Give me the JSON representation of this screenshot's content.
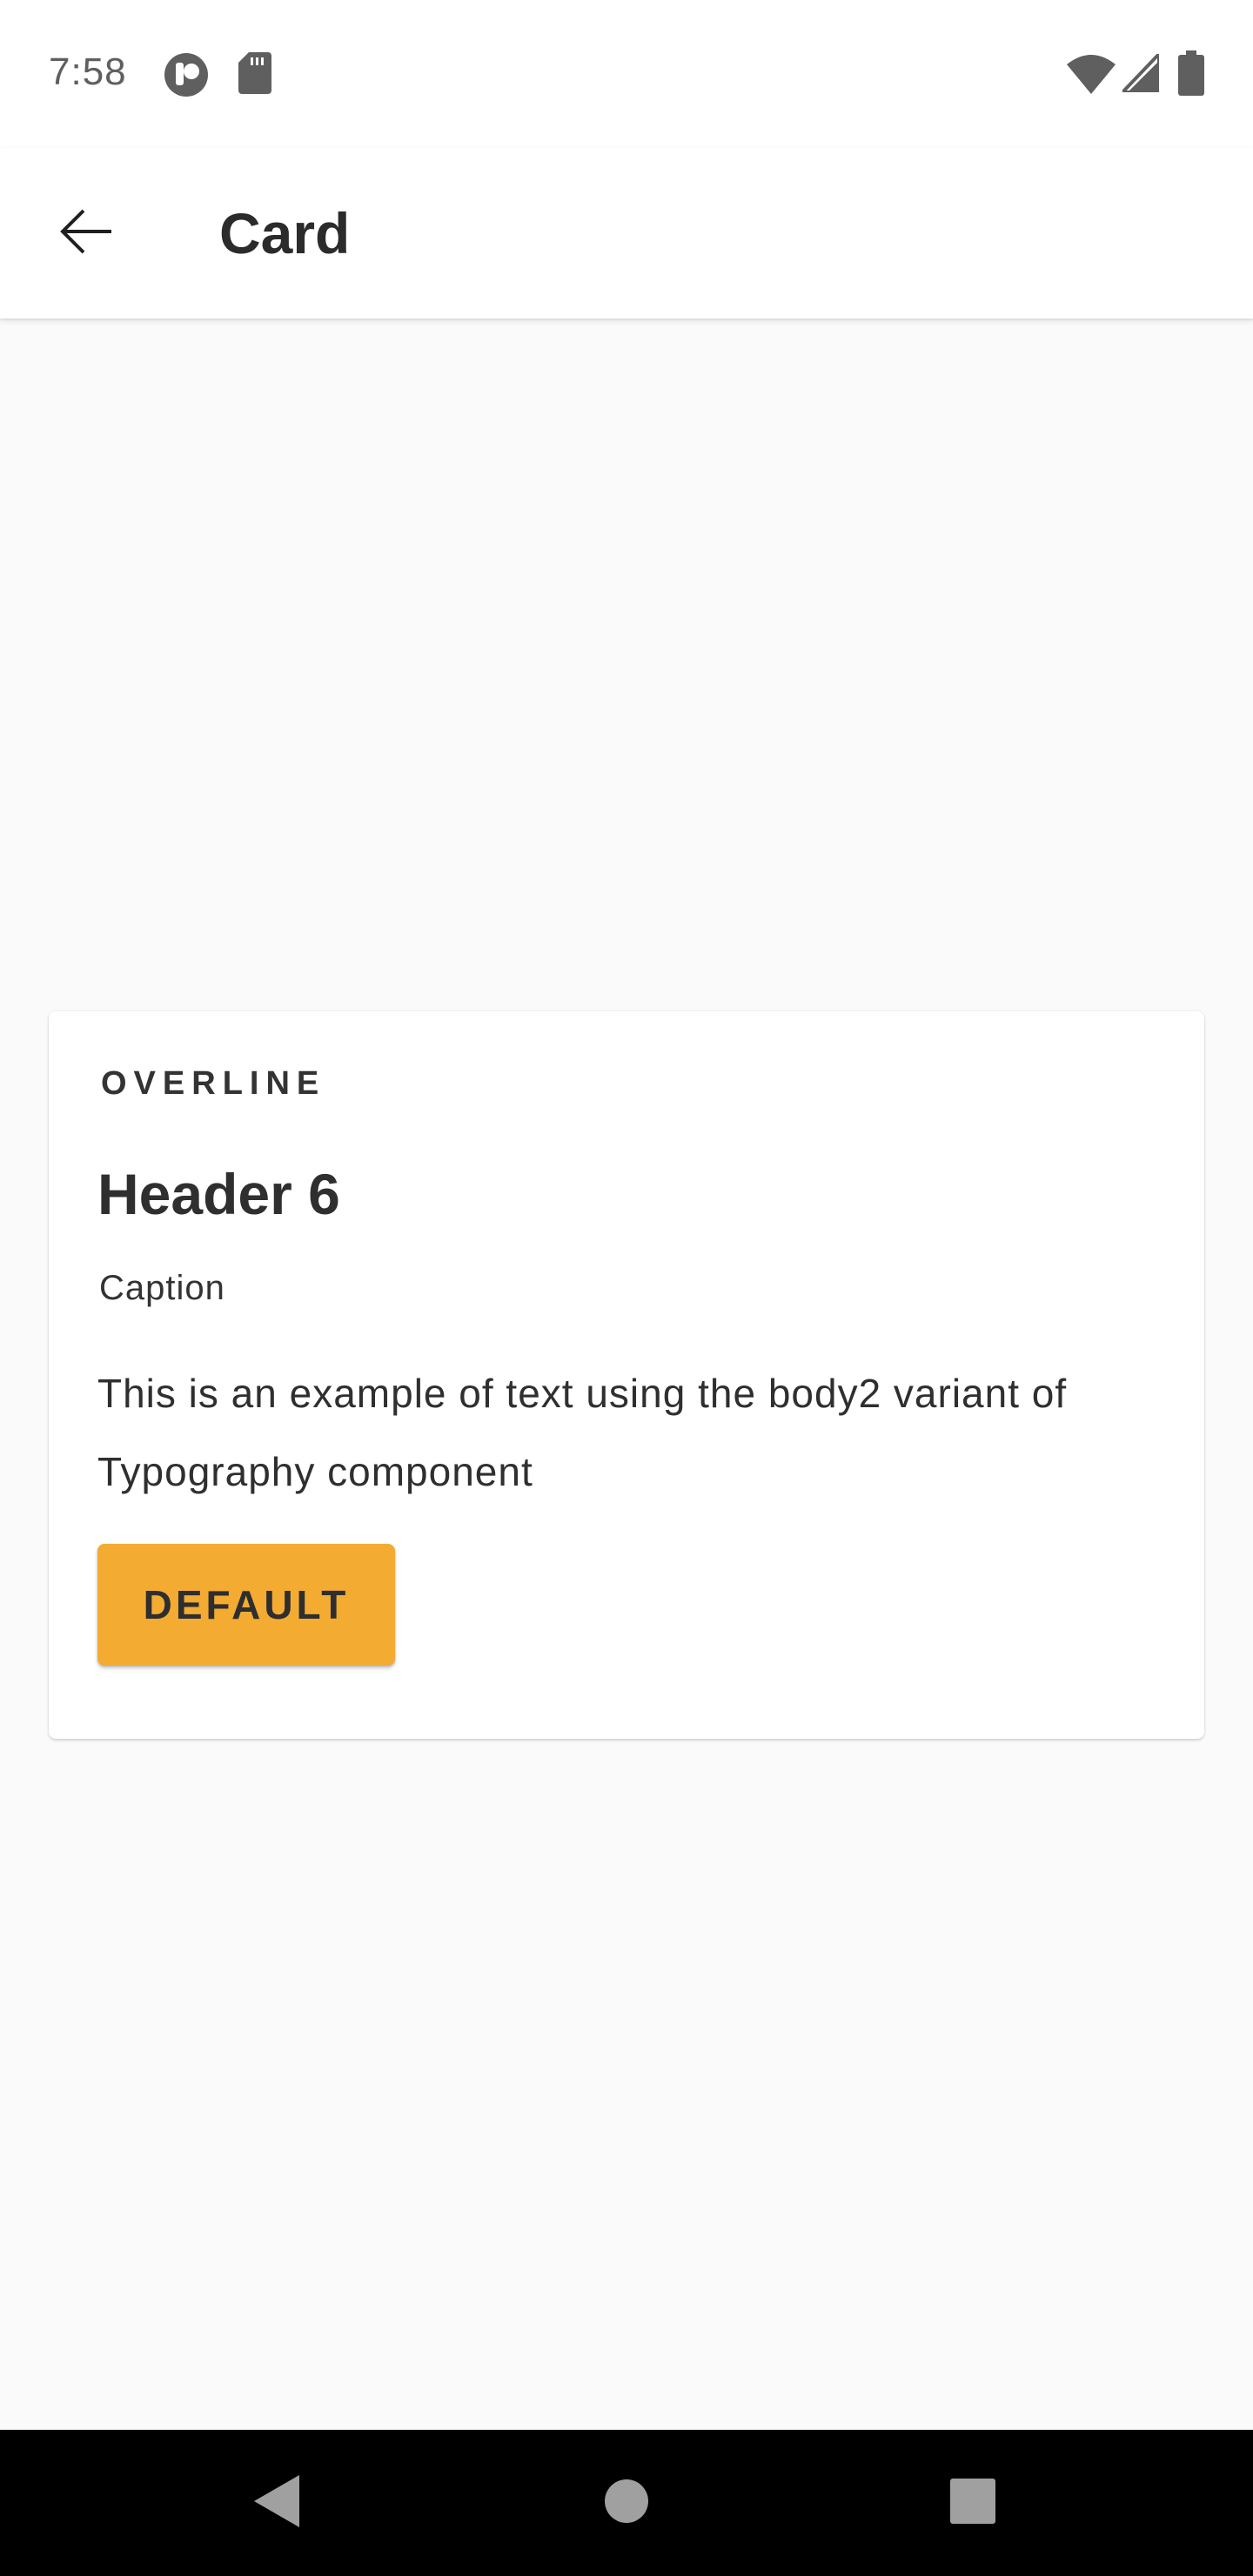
{
  "status_bar": {
    "time": "7:58",
    "icons": [
      "app-notification-icon",
      "sd-card-icon",
      "wifi-icon",
      "signal-icon",
      "battery-icon"
    ]
  },
  "app_bar": {
    "title": "Card",
    "back_icon": "arrow-back-icon"
  },
  "card": {
    "overline": "OVERLINE",
    "header": "Header 6",
    "caption": "Caption",
    "body": "This is an example of text using the body2 variant of Typography component",
    "button_label": "DEFAULT"
  },
  "nav_bar": {
    "icons": [
      "back-triangle-icon",
      "home-circle-icon",
      "recents-square-icon"
    ]
  },
  "colors": {
    "background": "#fafafa",
    "surface": "#ffffff",
    "button": "#f4ab32",
    "nav_bar": "#000000",
    "status_icons": "#5f5f5f"
  }
}
